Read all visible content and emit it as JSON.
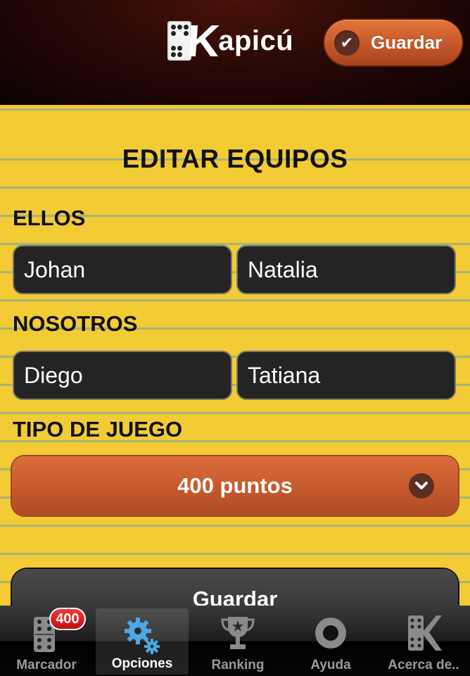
{
  "header": {
    "logo_text": "apicú",
    "logo_letter": "K",
    "save_label": "Guardar"
  },
  "content": {
    "title": "EDITAR EQUIPOS",
    "team1": {
      "label": "ELLOS",
      "player1": "Johan",
      "player2": "Natalia"
    },
    "team2": {
      "label": "NOSOTROS",
      "player1": "Diego",
      "player2": "Tatiana"
    },
    "game_type": {
      "label": "TIPO DE JUEGO",
      "selected": "400 puntos"
    },
    "bottom_button": "Guardar"
  },
  "tabbar": {
    "tabs": [
      {
        "label": "Marcador",
        "badge": "400"
      },
      {
        "label": "Opciones"
      },
      {
        "label": "Ranking"
      },
      {
        "label": "Ayuda"
      },
      {
        "label": "Acerca de.."
      }
    ]
  },
  "colors": {
    "accent_orange": "#c75b2f",
    "pad_yellow": "#f2cb35",
    "active_tab_blue": "#4aa8e6"
  },
  "icons": [
    "domino-icon",
    "gears-icon",
    "trophy-icon",
    "lifebuoy-icon",
    "k-domino-icon",
    "check-icon",
    "chevron-down-icon"
  ]
}
